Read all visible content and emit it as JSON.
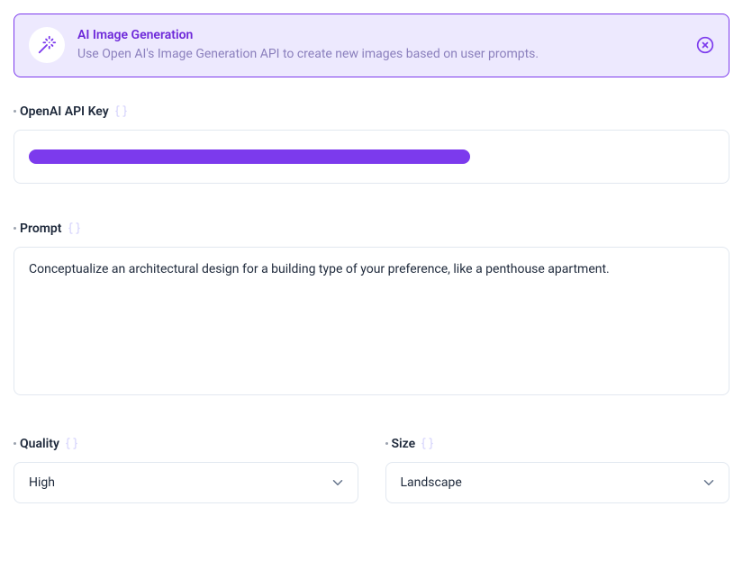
{
  "banner": {
    "title": "AI Image Generation",
    "description": "Use Open AI's Image Generation API to create new images based on user prompts."
  },
  "fields": {
    "api_key": {
      "label": "OpenAI API Key"
    },
    "prompt": {
      "label": "Prompt",
      "value": "Conceptualize an architectural design for a building type of your preference, like a penthouse apartment."
    },
    "quality": {
      "label": "Quality",
      "value": "High"
    },
    "size": {
      "label": "Size",
      "value": "Landscape"
    }
  }
}
